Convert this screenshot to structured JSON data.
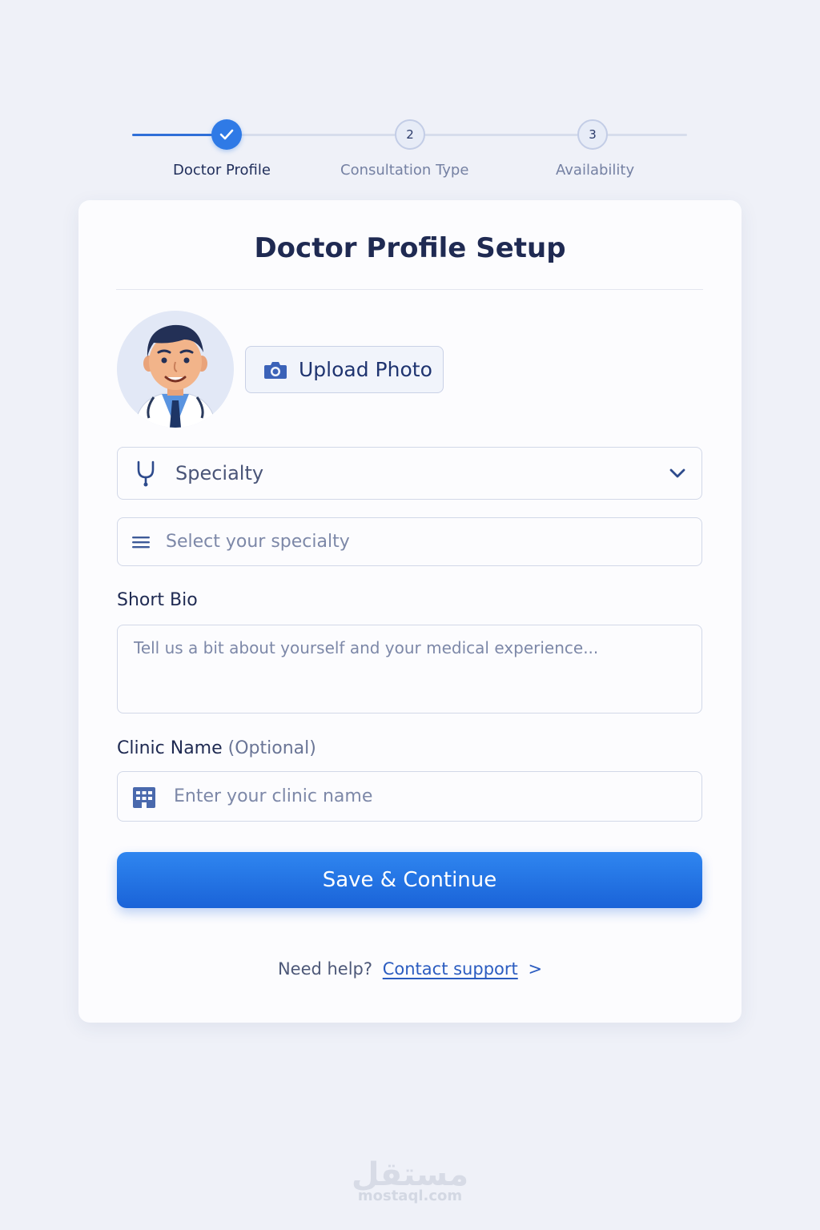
{
  "stepper": {
    "steps": [
      {
        "number": "1",
        "label": "Doctor Profile",
        "status": "done"
      },
      {
        "number": "2",
        "label": "Consultation Type",
        "status": "todo"
      },
      {
        "number": "3",
        "label": "Availability",
        "status": "todo"
      }
    ]
  },
  "card": {
    "title": "Doctor Profile Setup",
    "upload_label": "Upload Photo",
    "specialty": {
      "value": "Specialty",
      "icon": "stethoscope-icon"
    },
    "specialty_select": {
      "placeholder": "Select your specialty",
      "icon": "list-icon"
    },
    "bio": {
      "label": "Short Bio",
      "placeholder": "Tell us a bit about yourself and your medical experience..."
    },
    "clinic": {
      "label": "Clinic Name",
      "optional": "(Optional)",
      "placeholder": "Enter your clinic name",
      "icon": "building-icon"
    },
    "save_label": "Save & Continue",
    "help": {
      "text": "Need help?",
      "link": "Contact support",
      "arrow": ">"
    }
  },
  "watermark": {
    "arabic": "مستقل",
    "latin": "mostaql.com"
  },
  "colors": {
    "accent": "#2f7ae6",
    "button": "#1a63d8",
    "background": "#eff1f8"
  }
}
